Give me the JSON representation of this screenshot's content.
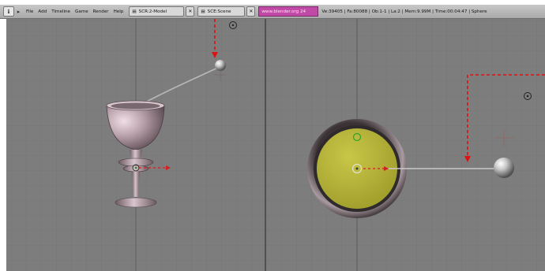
{
  "header": {
    "menu": [
      "File",
      "Add",
      "Timeline",
      "Game",
      "Render",
      "Help"
    ],
    "screen_field": "SCR:2-Model",
    "scene_field": "SCE:Scene",
    "active_field": "www.blender.org 24",
    "stats": "Ve:39405 | Fa:80088 | Ob:1-1 | La:2 | Mem:9.99M | Time:00:04:47 | Sphere"
  },
  "icons": {
    "window_type": "window-type-icon",
    "menu_toggle": "menu-toggle-icon",
    "close_screen": "close-icon",
    "close_scene": "close-icon",
    "scene_icon": "scene-icon"
  },
  "colors": {
    "viewport_bg": "#7d7d7d",
    "grid_line": "#6f6f6f",
    "axis_line": "#5a5a5a",
    "annotation_arrow": "#e01010",
    "disk_fill": "#b5b33a",
    "header_active": "#c04aa6"
  }
}
